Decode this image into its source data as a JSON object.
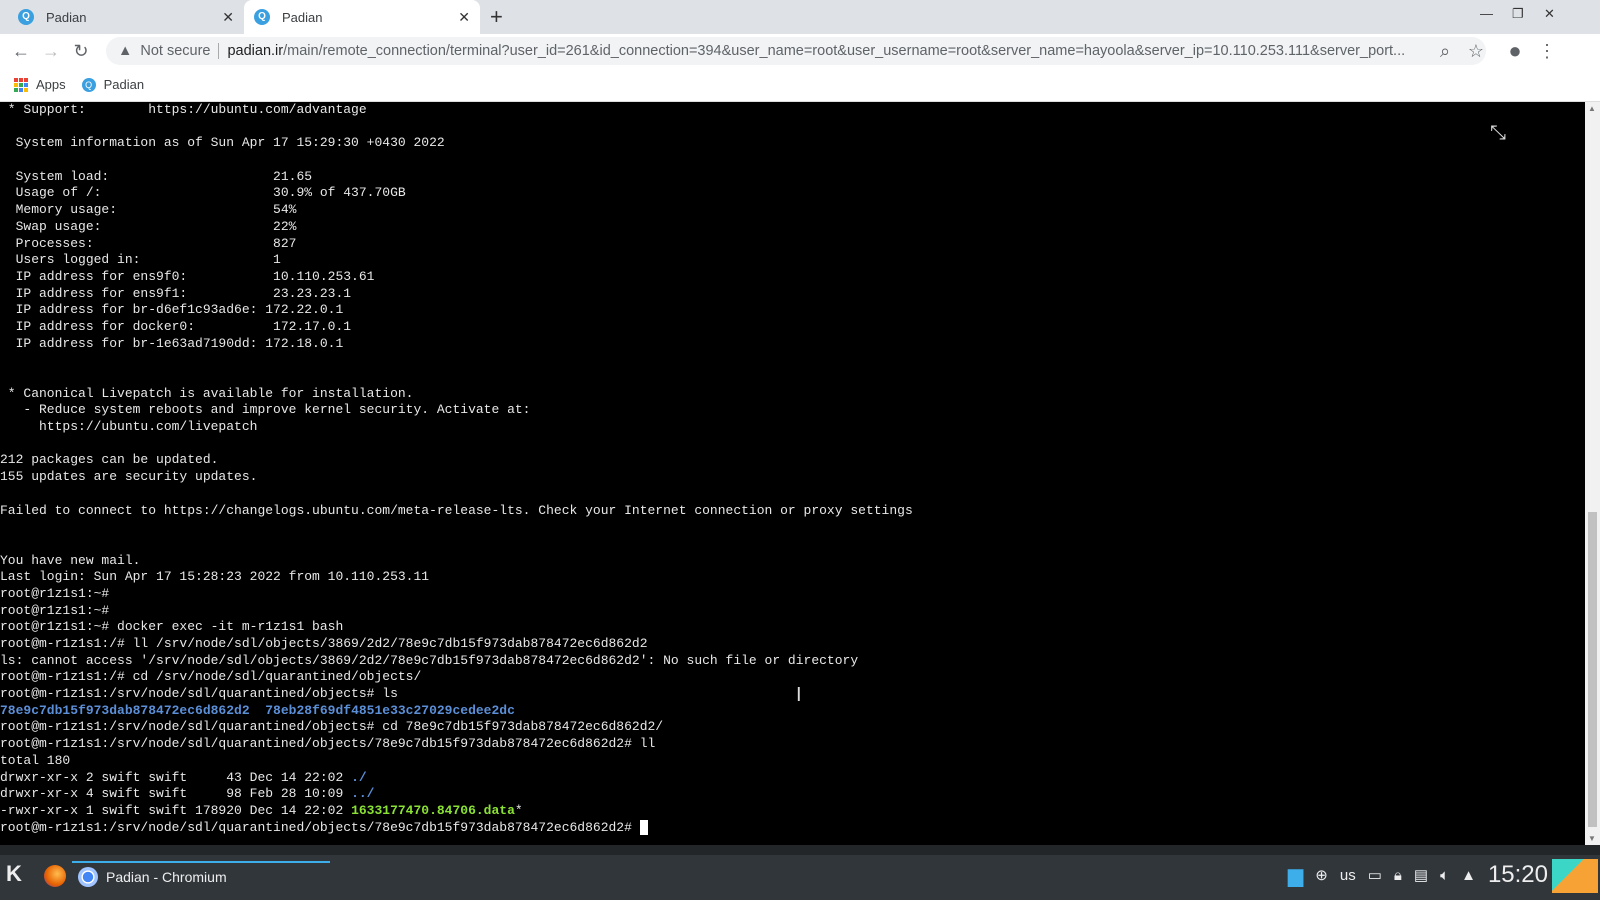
{
  "browser": {
    "tabs": [
      {
        "label": "Padian",
        "active": false
      },
      {
        "label": "Padian",
        "active": true
      }
    ],
    "url_host": "padian.ir",
    "url_path": "/main/remote_connection/terminal?user_id=261&id_connection=394&user_name=root&user_username=root&server_name=hayoola&server_ip=10.110.253.111&server_port...",
    "security": "Not secure",
    "bookmarks": [
      {
        "label": "Apps"
      },
      {
        "label": "Padian"
      }
    ]
  },
  "terminal": {
    "colors": {
      "default": "#e8e8e8",
      "dir": "#5b8fd8",
      "exec": "#8ae234"
    },
    "lines": [
      [
        {
          "t": " * Support:        https://ubuntu.com/advantage"
        }
      ],
      [],
      [
        {
          "t": "  System information as of Sun Apr 17 15:29:30 +0430 2022"
        }
      ],
      [],
      [
        {
          "t": "  System load:                     21.65"
        }
      ],
      [
        {
          "t": "  Usage of /:                      30.9% of 437.70GB"
        }
      ],
      [
        {
          "t": "  Memory usage:                    54%"
        }
      ],
      [
        {
          "t": "  Swap usage:                      22%"
        }
      ],
      [
        {
          "t": "  Processes:                       827"
        }
      ],
      [
        {
          "t": "  Users logged in:                 1"
        }
      ],
      [
        {
          "t": "  IP address for ens9f0:           10.110.253.61"
        }
      ],
      [
        {
          "t": "  IP address for ens9f1:           23.23.23.1"
        }
      ],
      [
        {
          "t": "  IP address for br-d6ef1c93ad6e: 172.22.0.1"
        }
      ],
      [
        {
          "t": "  IP address for docker0:          172.17.0.1"
        }
      ],
      [
        {
          "t": "  IP address for br-1e63ad7190dd: 172.18.0.1"
        }
      ],
      [],
      [],
      [
        {
          "t": " * Canonical Livepatch is available for installation."
        }
      ],
      [
        {
          "t": "   - Reduce system reboots and improve kernel security. Activate at:"
        }
      ],
      [
        {
          "t": "     https://ubuntu.com/livepatch"
        }
      ],
      [],
      [
        {
          "t": "212 packages can be updated."
        }
      ],
      [
        {
          "t": "155 updates are security updates."
        }
      ],
      [],
      [
        {
          "t": "Failed to connect to https://changelogs.ubuntu.com/meta-release-lts. Check your Internet connection or proxy settings"
        }
      ],
      [],
      [],
      [
        {
          "t": "You have new mail."
        }
      ],
      [
        {
          "t": "Last login: Sun Apr 17 15:28:23 2022 from 10.110.253.11"
        }
      ],
      [
        {
          "t": "root@r1z1s1:~#"
        }
      ],
      [
        {
          "t": "root@r1z1s1:~#"
        }
      ],
      [
        {
          "t": "root@r1z1s1:~# docker exec -it m-r1z1s1 bash"
        }
      ],
      [
        {
          "t": "root@m-r1z1s1:/# ll /srv/node/sdl/objects/3869/2d2/78e9c7db15f973dab878472ec6d862d2"
        }
      ],
      [
        {
          "t": "ls: cannot access '/srv/node/sdl/objects/3869/2d2/78e9c7db15f973dab878472ec6d862d2': No such file or directory"
        }
      ],
      [
        {
          "t": "root@m-r1z1s1:/# cd /srv/node/sdl/quarantined/objects/"
        }
      ],
      [
        {
          "t": "root@m-r1z1s1:/srv/node/sdl/quarantined/objects# ls"
        }
      ],
      [
        {
          "t": "78e9c7db15f973dab878472ec6d862d2",
          "c": "dir"
        },
        {
          "t": "  "
        },
        {
          "t": "78eb28f69df4851e33c27029cedee2dc",
          "c": "dir"
        }
      ],
      [
        {
          "t": "root@m-r1z1s1:/srv/node/sdl/quarantined/objects# cd 78e9c7db15f973dab878472ec6d862d2/"
        }
      ],
      [
        {
          "t": "root@m-r1z1s1:/srv/node/sdl/quarantined/objects/78e9c7db15f973dab878472ec6d862d2# ll"
        }
      ],
      [
        {
          "t": "total 180"
        }
      ],
      [
        {
          "t": "drwxr-xr-x 2 swift swift     43 Dec 14 22:02 "
        },
        {
          "t": "./",
          "c": "dir"
        }
      ],
      [
        {
          "t": "drwxr-xr-x 4 swift swift     98 Feb 28 10:09 "
        },
        {
          "t": "../",
          "c": "dir"
        }
      ],
      [
        {
          "t": "-rwxr-xr-x 1 swift swift 178920 Dec 14 22:02 "
        },
        {
          "t": "1633177470.84706.data",
          "c": "exec"
        },
        {
          "t": "*"
        }
      ],
      [
        {
          "t": "root@m-r1z1s1:/srv/node/sdl/quarantined/objects/78e9c7db15f973dab878472ec6d862d2# "
        }
      ]
    ]
  },
  "taskbar": {
    "task_label": "Padian - Chromium",
    "keyboard_layout": "us",
    "clock": "15:20"
  }
}
